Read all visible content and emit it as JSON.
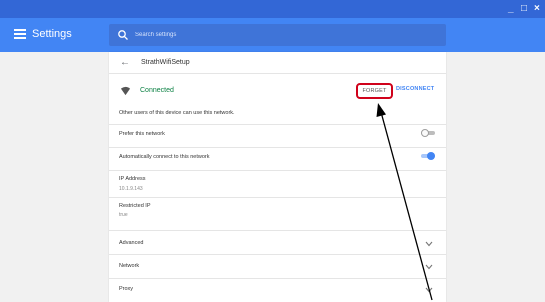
{
  "window": {
    "minimize_icon": "minimize-icon",
    "maximize_icon": "maximize-icon",
    "close_icon": "close-icon",
    "minimize_label": "_",
    "maximize_label": "□",
    "close_label": "×"
  },
  "header": {
    "title": "Settings",
    "menu_icon": "hamburger-menu-icon",
    "bg_color": "#4285f4"
  },
  "search": {
    "placeholder": "Search settings",
    "icon": "search-icon"
  },
  "network": {
    "back_label": "←",
    "name": "StrathWifiSetup",
    "status": "Connected",
    "status_color": "#0b8043",
    "forget_label": "FORGET",
    "disconnect_label": "DISCONNECT",
    "note": "Other users of this device can use this network."
  },
  "settings": {
    "prefer": {
      "label": "Prefer this network",
      "enabled": false
    },
    "auto_connect": {
      "label": "Automatically connect to this network",
      "enabled": true
    },
    "ip_address": {
      "label": "IP Address",
      "value": "10.1.9.143"
    },
    "restricted_ip": {
      "label": "Restricted IP",
      "value": "true"
    }
  },
  "sections": [
    {
      "label": "Advanced"
    },
    {
      "label": "Network"
    },
    {
      "label": "Proxy"
    }
  ],
  "annotation": {
    "highlight_color": "#d0021b",
    "arrow_color": "#000000"
  }
}
